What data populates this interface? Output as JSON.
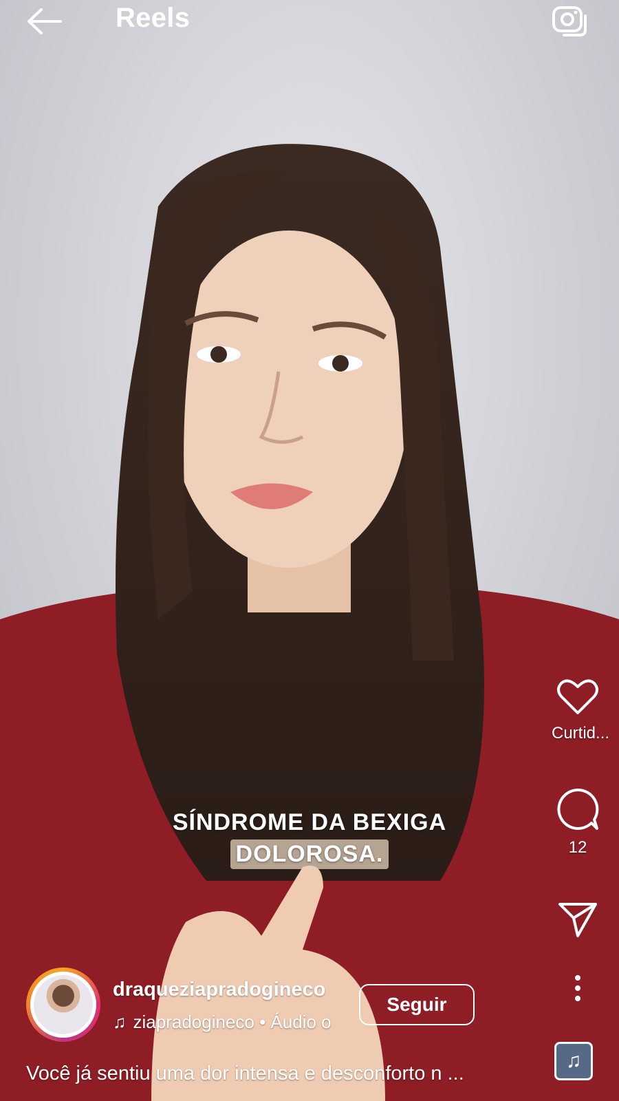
{
  "header": {
    "title": "Reels",
    "back_icon": "arrow-left-icon",
    "camera_icon": "camera-icon"
  },
  "video": {
    "caption_line1": "SÍNDROME DA BEXIGA",
    "caption_line2": "DOLOROSA."
  },
  "actions": {
    "like_label": "Curtid...",
    "comment_count": "12",
    "like_icon": "heart-icon",
    "comment_icon": "comment-icon",
    "share_icon": "send-icon",
    "more_icon": "more-vertical-icon",
    "audio_icon": "music-note-icon"
  },
  "post": {
    "username": "draqueziapradogineco",
    "audio_text": "ziapradogineco • Áudio o",
    "follow_label": "Seguir",
    "description": "Você já sentiu uma dor intensa e desconforto n ..."
  },
  "colors": {
    "sweater": "#8e1d25",
    "follow_border": "#ffffff",
    "story_ring": "#e1306c"
  }
}
